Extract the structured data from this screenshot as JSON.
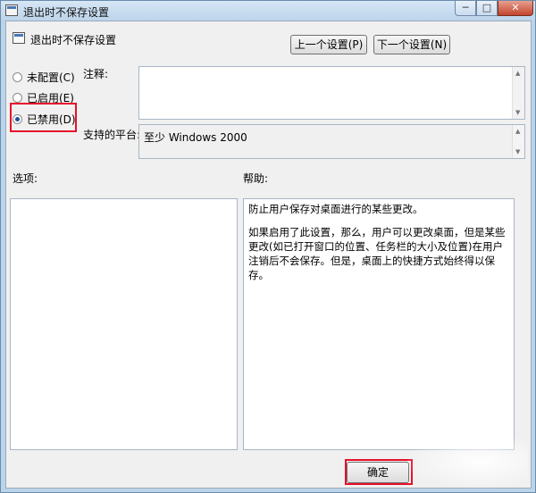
{
  "window": {
    "title": "退出时不保存设置"
  },
  "window_controls": {
    "minimize": "─",
    "maximize": "□",
    "close": "✕"
  },
  "header": {
    "title": "退出时不保存设置",
    "prev_button": "上一个设置(P)",
    "next_button": "下一个设置(N)"
  },
  "radios": [
    {
      "label": "未配置(C)",
      "selected": false
    },
    {
      "label": "已启用(E)",
      "selected": false
    },
    {
      "label": "已禁用(D)",
      "selected": true
    }
  ],
  "comment": {
    "label": "注释:",
    "value": ""
  },
  "platform": {
    "label": "支持的平台:",
    "value": "至少 Windows 2000"
  },
  "options": {
    "label": "选项:"
  },
  "help": {
    "label": "帮助:",
    "paragraph1": "防止用户保存对桌面进行的某些更改。",
    "paragraph2": "如果启用了此设置，那么，用户可以更改桌面，但是某些更改(如已打开窗口的位置、任务栏的大小及位置)在用户注销后不会保存。但是，桌面上的快捷方式始终得以保存。"
  },
  "footer": {
    "ok_button": "确定"
  },
  "colors": {
    "highlight": "#e8102a",
    "window_frame": "#bcd4ea"
  },
  "icons": {
    "app": "policy-setting-icon"
  }
}
